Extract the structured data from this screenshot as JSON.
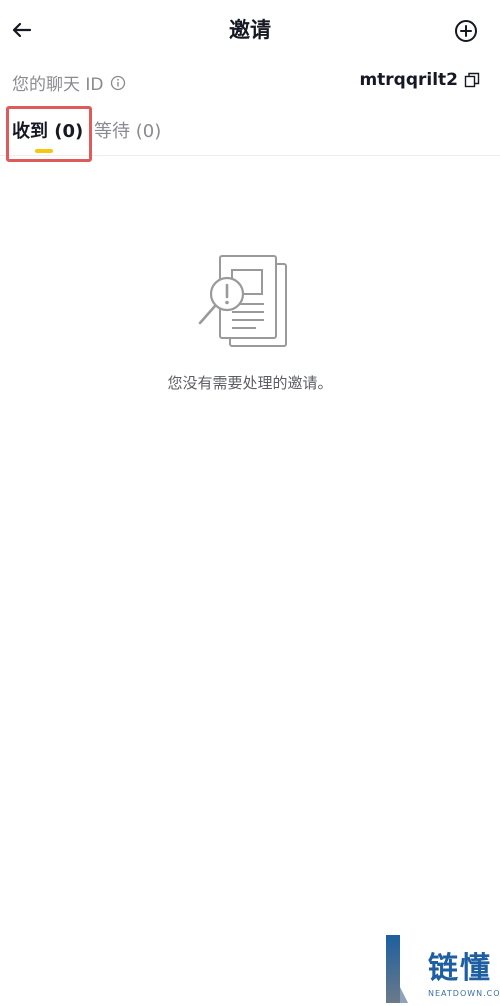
{
  "header": {
    "title": "邀请"
  },
  "chat_id": {
    "label": "您的聊天 ID",
    "value": "mtrqqrilt2"
  },
  "tabs": [
    {
      "label": "收到 (0)",
      "selected": true
    },
    {
      "label": "等待 (0)",
      "selected": false
    }
  ],
  "empty_state": {
    "message": "您没有需要处理的邀请。",
    "icon": "document-search-alert-icon"
  },
  "watermark": {
    "text_cn": "链懂",
    "text_en": "NEATDOWN.COM"
  },
  "colors": {
    "accent": "#f6c80e",
    "highlight": "#e05a5a",
    "muted": "#8a8b91"
  }
}
